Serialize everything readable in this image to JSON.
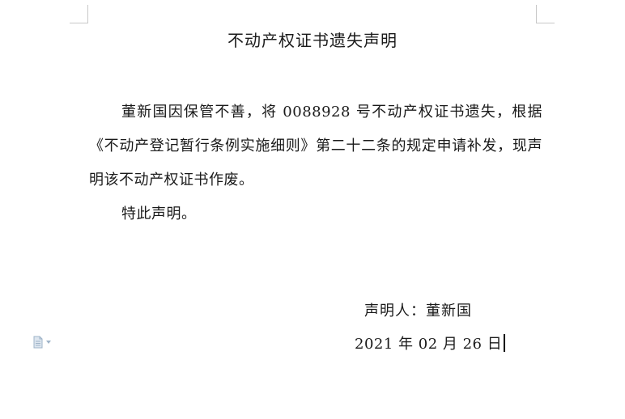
{
  "document": {
    "title": "不动产权证书遗失声明",
    "paragraphs": [
      "董新国因保管不善，将 0088928 号不动产权证书遗失，根据《不动产登记暂行条例实施细则》第二十二条的规定申请补发，现声明该不动产权证书作废。",
      "特此声明。"
    ],
    "signature": {
      "label": "声明人：董新国",
      "date": "2021 年 02 月 26 日"
    }
  },
  "ui": {
    "paste_options_icon": "document-icon",
    "dropdown_icon": "caret-down-icon",
    "accent_color": "#9fb4c8"
  }
}
